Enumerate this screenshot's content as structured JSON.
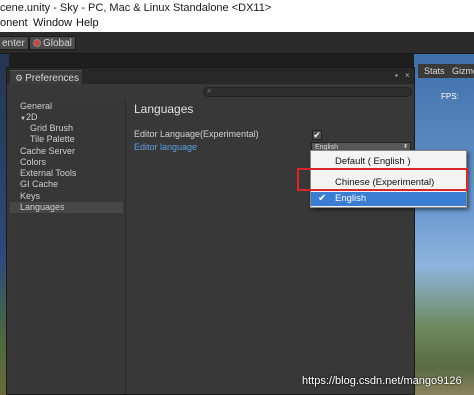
{
  "titlebar": {
    "text": "cene.unity - Sky - PC, Mac & Linux Standalone <DX11>"
  },
  "menubar": {
    "items": [
      "onent",
      "Window",
      "Help"
    ]
  },
  "toolbar": {
    "center_label": "enter",
    "global_label": "Global"
  },
  "scene_toolbar": {
    "stats": "Stats",
    "gizmos": "Gizmo"
  },
  "scene": {
    "fps": "FPS:"
  },
  "preferences": {
    "tab_title": "Preferences",
    "sidebar": [
      "General",
      "2D",
      "Grid Brush",
      "Tile Palette",
      "Cache Server",
      "Colors",
      "External Tools",
      "GI Cache",
      "Keys",
      "Languages"
    ],
    "selected_index": 9,
    "content": {
      "title": "Languages",
      "editor_language_experimental_label": "Editor Language(Experimental)",
      "editor_language_experimental_checked": true,
      "editor_language_label": "Editor language",
      "editor_language_value": "English"
    }
  },
  "dropdown": {
    "items": [
      "Default ( English )",
      "Chinese (Experimental)",
      "English"
    ],
    "selected": "English"
  },
  "watermark": "https://blog.csdn.net/mango9126"
}
